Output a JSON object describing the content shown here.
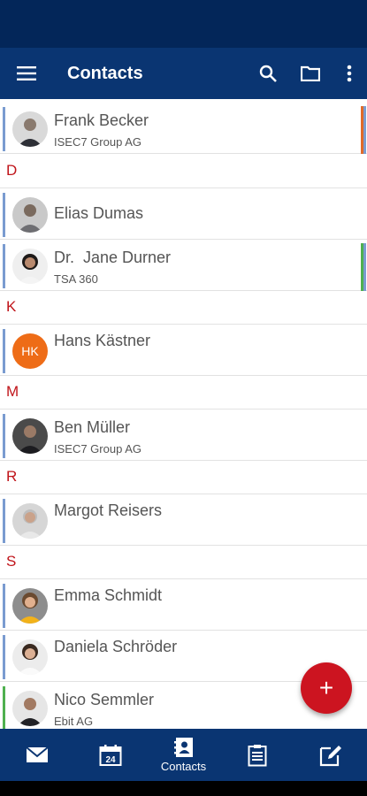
{
  "app": {
    "title": "Contacts"
  },
  "appbar": {
    "menu_icon": "hamburger-menu-icon",
    "actions": [
      "search-icon",
      "folder-icon",
      "more-vert-icon"
    ]
  },
  "sections": [
    {
      "letter": ""
    },
    {
      "letter": "D"
    },
    {
      "letter": "K"
    },
    {
      "letter": "M"
    },
    {
      "letter": "R"
    },
    {
      "letter": "S"
    }
  ],
  "contacts": [
    {
      "name": "Frank Becker",
      "company": "ISEC7 Group AG",
      "tags": [
        "#e06a2a",
        "#7a9bd0"
      ]
    },
    {
      "name": "Elias Dumas",
      "company": ""
    },
    {
      "name": "Dr.  Jane Durner",
      "company": "TSA 360",
      "tags": [
        "#4fb04f",
        "#7a9bd0"
      ]
    },
    {
      "name": "Hans Kästner",
      "company": "",
      "initials": "HK",
      "initials_color": "#ee6c17"
    },
    {
      "name": "Ben Müller",
      "company": "ISEC7 Group AG"
    },
    {
      "name": "Margot Reisers",
      "company": ""
    },
    {
      "name": "Emma Schmidt",
      "company": ""
    },
    {
      "name": "Daniela Schröder",
      "company": ""
    },
    {
      "name": "Nico Semmler",
      "company": "Ebit AG"
    }
  ],
  "fab": {
    "icon": "add-icon",
    "label": "+"
  },
  "bottom_nav": {
    "items": [
      {
        "icon": "mail-icon",
        "label": ""
      },
      {
        "icon": "calendar-icon",
        "label": "",
        "badge": "24"
      },
      {
        "icon": "contacts-icon",
        "label": "Contacts"
      },
      {
        "icon": "tasks-clipboard-icon",
        "label": ""
      },
      {
        "icon": "notes-edit-icon",
        "label": ""
      }
    ]
  },
  "colors": {
    "appbar": "#0a3572",
    "statusbar": "#032659",
    "accent_red": "#cc1420",
    "section_letter": "#c0141a"
  }
}
